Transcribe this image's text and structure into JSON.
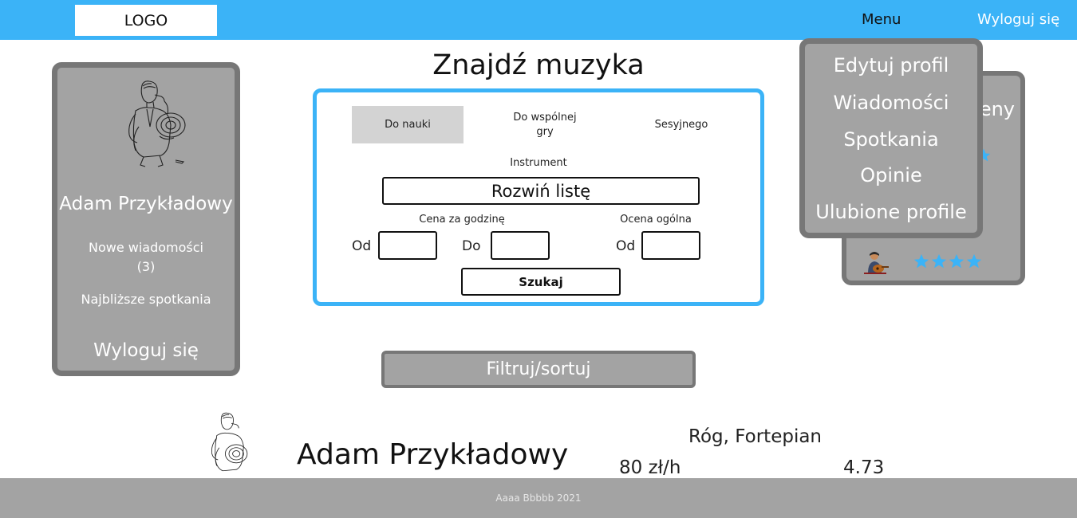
{
  "header": {
    "logo": "LOGO",
    "menu_label": "Menu",
    "logout_label": "Wyloguj się",
    "bar_color": "#3bb3f7"
  },
  "profile_card": {
    "name": "Adam Przykładowy",
    "new_messages_label": "Nowe wiadomości",
    "new_messages_count": "(3)",
    "upcoming_meetings": "Najbliższe spotkania",
    "logout": "Wyloguj się",
    "avatar_icon": "horn-player-icon"
  },
  "page_title": "Znajdź muzyka",
  "search": {
    "tabs": [
      {
        "label": "Do nauki",
        "active": true
      },
      {
        "label": "Do wspólnej gry",
        "active": false
      },
      {
        "label": "Sesyjnego",
        "active": false
      }
    ],
    "instrument_label": "Instrument",
    "instrument_dropdown": "Rozwiń listę",
    "price_label": "Cena za godzinę",
    "rating_label": "Ocena ogólna",
    "from_label": "Od",
    "to_label": "Do",
    "rating_from_label": "Od",
    "price_from_value": "",
    "price_to_value": "",
    "rating_from_value": "",
    "search_button": "Szukaj",
    "border_color": "#3bb3f7"
  },
  "filter_button": "Filtruj/sortuj",
  "ratings_card": {
    "title_partial": "eny",
    "review_stars": 4,
    "star_color": "#3bb3f7",
    "reviewer_icon": "guitarist-icon"
  },
  "menu": {
    "items": [
      "Edytuj profil",
      "Wiadomości",
      "Spotkania",
      "Opinie",
      "Ulubione profile"
    ]
  },
  "result": {
    "name": "Adam Przykładowy",
    "instruments": "Róg, Fortepian",
    "price": "80 zł/h",
    "rating": "4.73",
    "avatar_icon": "horn-player-icon"
  },
  "footer": "Aaaa Bbbbb 2021"
}
